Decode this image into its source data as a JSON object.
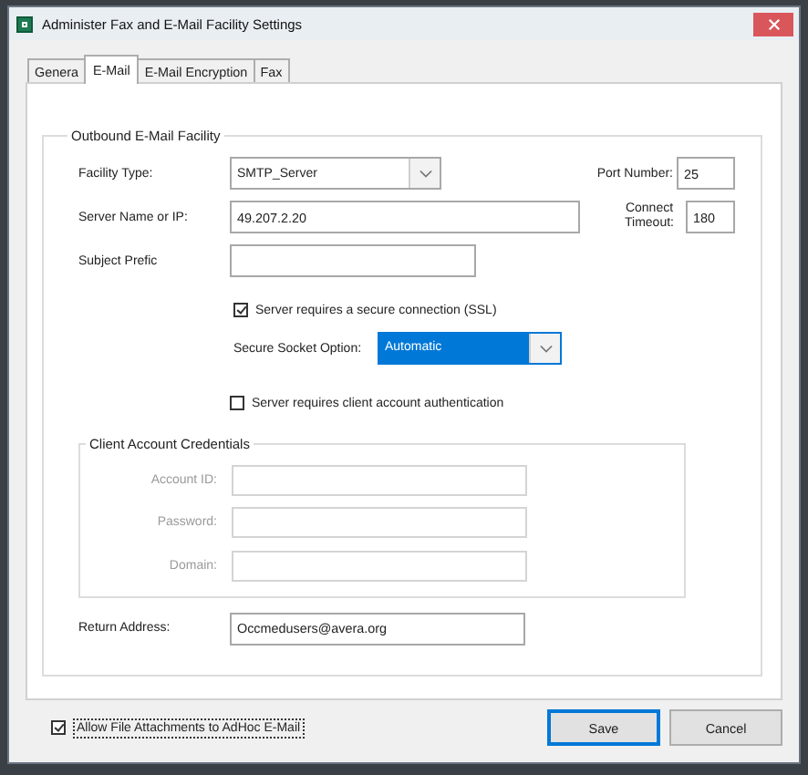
{
  "window": {
    "title": "Administer Fax and E-Mail Facility Settings"
  },
  "tabs": [
    {
      "label": "Genera",
      "selected": false
    },
    {
      "label": "E-Mail",
      "selected": true
    },
    {
      "label": "E-Mail Encryption",
      "selected": false
    },
    {
      "label": "Fax",
      "selected": false
    }
  ],
  "outbound": {
    "title": "Outbound E-Mail Facility",
    "facility_type": {
      "label": "Facility Type:",
      "value": "SMTP_Server"
    },
    "port_number": {
      "label": "Port Number:",
      "value": "25"
    },
    "server_name": {
      "label": "Server Name or IP:",
      "value": "49.207.2.20"
    },
    "connect_timeout": {
      "label": "Connect Timeout:",
      "value": "180"
    },
    "subject_prefix": {
      "label": "Subject Prefic"
    },
    "ssl": {
      "label": "Server requires a secure connection (SSL)",
      "checked": true
    },
    "secure_socket_option": {
      "label": "Secure Socket Option:",
      "value": "Automatic",
      "highlighted": true
    },
    "client_auth": {
      "label": "Server requires client account authentication",
      "checked": false
    },
    "credentials": {
      "title": "Client Account Credentials",
      "disabled": true,
      "fields": [
        {
          "label": "Account ID:"
        },
        {
          "label": "Password:"
        },
        {
          "label": "Domain:"
        }
      ]
    },
    "return_address": {
      "label": "Return Address:",
      "value": "Occmedusers@avera.org"
    }
  },
  "allow_attachments": {
    "label": "Allow File Attachments to AdHoc E-Mail",
    "checked": true
  },
  "buttons": [
    {
      "label": "Save",
      "default": true
    },
    {
      "label": "Cancel",
      "default": false
    }
  ]
}
